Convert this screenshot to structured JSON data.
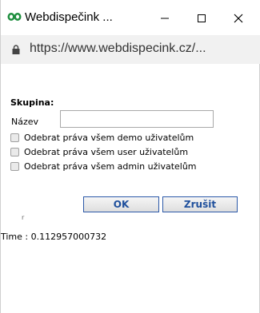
{
  "window": {
    "title": "Webdispečink ...",
    "accent_icon_color": "#1e8e3e"
  },
  "controls": {
    "minimize": "—",
    "maximize": "☐",
    "close": "✕"
  },
  "address": {
    "url": "https://www.webdispecink.cz/..."
  },
  "form": {
    "heading": "Skupina:",
    "name_label": "Název",
    "name_value": "",
    "checks": [
      {
        "label": "Odebrat práva všem demo uživatelům",
        "checked": false
      },
      {
        "label": "Odebrat práva všem user uživatelům",
        "checked": false
      },
      {
        "label": "Odebrat práva všem admin uživatelům",
        "checked": false
      }
    ],
    "ok_label": "OK",
    "cancel_label": "Zrušit"
  },
  "footer": {
    "mark": "r",
    "time": "Time : 0.112957000732"
  }
}
